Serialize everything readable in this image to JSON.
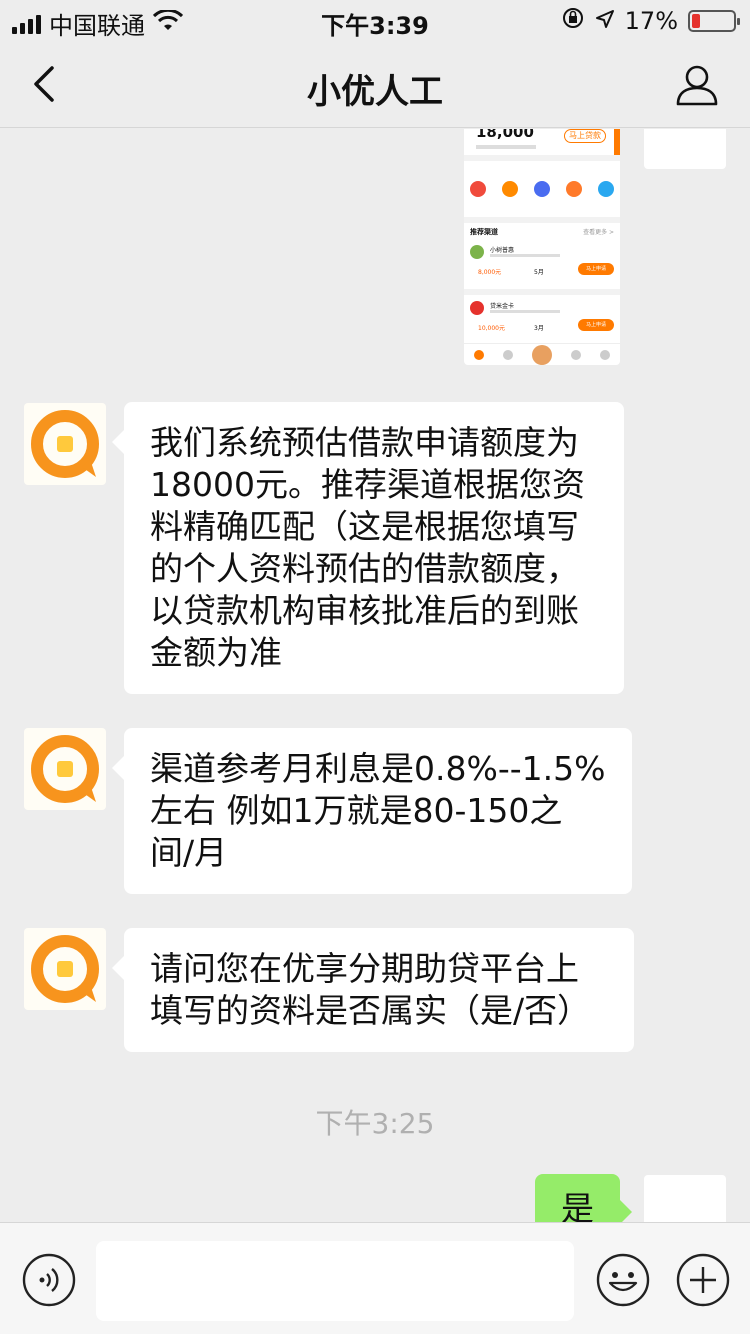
{
  "status_bar": {
    "carrier": "中国联通",
    "time": "下午3:39",
    "battery": "17%",
    "icons": [
      "signal-icon",
      "wifi-icon",
      "orientation-lock-icon",
      "location-icon",
      "battery-icon"
    ]
  },
  "nav": {
    "title": "小优人工",
    "back_icon": "back-chevron-icon",
    "profile_icon": "person-icon"
  },
  "screenshot_preview": {
    "amount": "18,000",
    "apply_label": "马上贷款",
    "section_title": "推荐渠道",
    "section_more": "查看更多 >",
    "cards": [
      {
        "name": "小树普惠",
        "value": "8,000元",
        "term": "5月",
        "button": "马上申请"
      },
      {
        "name": "贷米金卡",
        "value": "10,000元",
        "term": "3月",
        "button": "马上申请"
      }
    ]
  },
  "messages": [
    {
      "sender": "agent",
      "text": "我们系统预估借款申请额度为18000元。推荐渠道根据您资料精确匹配（这是根据您填写的个人资料预估的借款额度，以贷款机构审核批准后的到账金额为准"
    },
    {
      "sender": "agent",
      "text": "渠道参考月利息是0.8%--1.5%左右 例如1万就是80-150之间/月"
    },
    {
      "sender": "agent",
      "text": "请问您在优享分期助贷平台上填写的资料是否属实（是/否）"
    }
  ],
  "timestamp": "下午3:25",
  "my_reply": "是",
  "input_bar": {
    "placeholder": "",
    "icons": [
      "voice-icon",
      "emoji-icon",
      "plus-icon"
    ]
  },
  "colors": {
    "background": "#ededed",
    "bubble_me": "#95ec69",
    "brand_orange": "#ff7a00",
    "battery_low": "#e5322d"
  }
}
